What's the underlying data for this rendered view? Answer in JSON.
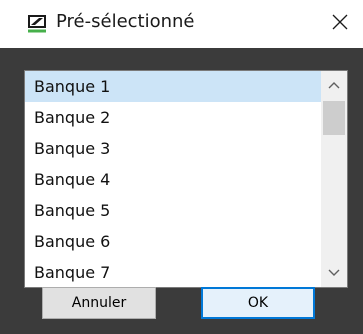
{
  "window": {
    "title": "Pré-sélectionné",
    "icon": "app-logo-icon",
    "close_icon": "close-icon"
  },
  "listbox": {
    "selected_index": 0,
    "items": [
      {
        "label": "Banque 1"
      },
      {
        "label": "Banque 2"
      },
      {
        "label": "Banque 3"
      },
      {
        "label": "Banque 4"
      },
      {
        "label": "Banque 5"
      },
      {
        "label": "Banque 6"
      },
      {
        "label": "Banque 7"
      }
    ],
    "scroll_up_icon": "chevron-up-icon",
    "scroll_down_icon": "chevron-down-icon"
  },
  "buttons": {
    "cancel_label": "Annuler",
    "ok_label": "OK"
  },
  "colors": {
    "accent": "#0078d7",
    "selection": "#cce4f7",
    "body_background": "#3b3b3b",
    "logo_green": "#47b04b"
  }
}
